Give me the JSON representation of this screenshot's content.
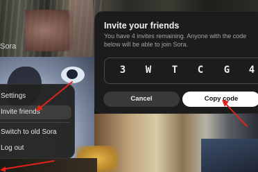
{
  "background": {
    "partial_label": "Sora"
  },
  "menu": {
    "items": [
      {
        "label": "Settings"
      },
      {
        "label": "Invite friends"
      },
      {
        "label": "Switch to old Sora"
      },
      {
        "label": "Log out"
      }
    ],
    "highlighted_index": 1
  },
  "invite_dialog": {
    "title": "Invite your friends",
    "description": "You have 4 invites remaining. Anyone with the code below will be able to join Sora.",
    "code": [
      "3",
      "W",
      "T",
      "C",
      "G",
      "4"
    ],
    "cancel_label": "Cancel",
    "copy_label": "Copy code"
  },
  "annotation_color": "#e2231a"
}
